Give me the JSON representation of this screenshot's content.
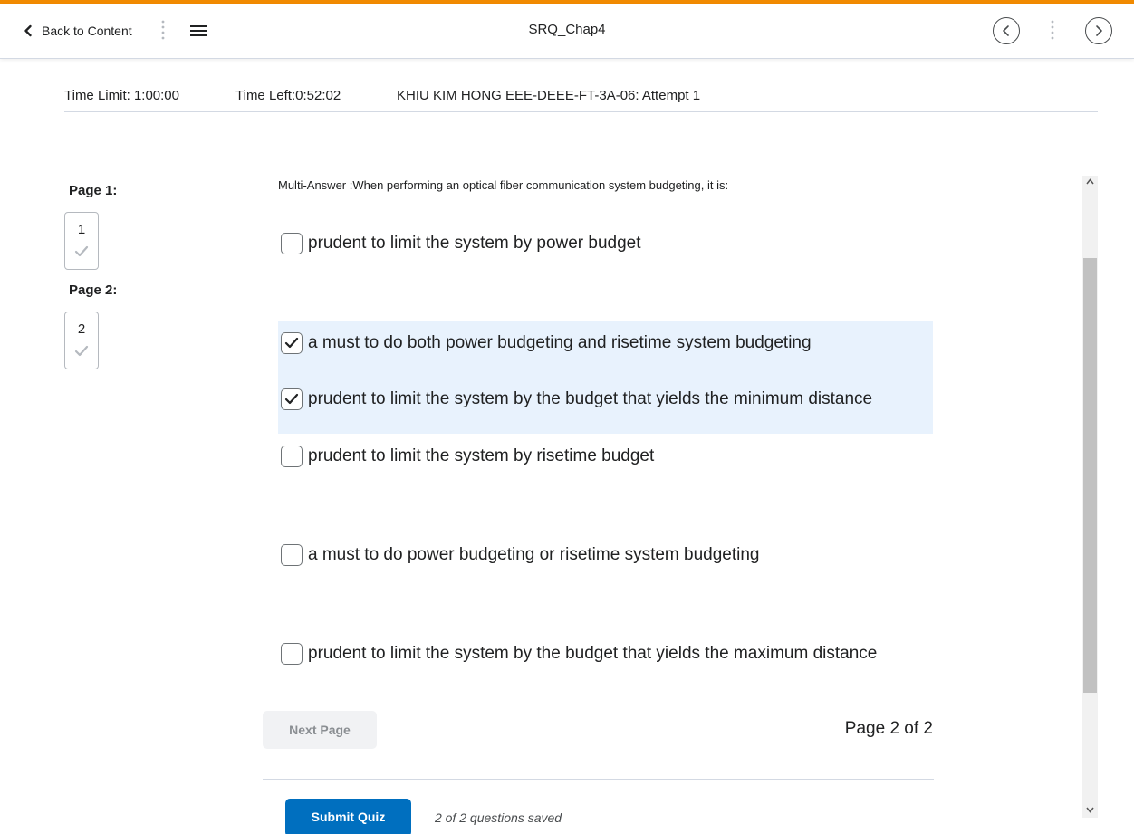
{
  "colors": {
    "accent": "#f18a00",
    "primary_button": "#006fbf",
    "highlight": "#e8f2fd"
  },
  "header": {
    "back_label": "Back to Content",
    "title": "SRQ_Chap4",
    "icons": [
      "chevron-left-icon",
      "vertical-dots-icon",
      "menu-icon",
      "previous-circle-icon",
      "next-circle-icon"
    ]
  },
  "quiz_info": {
    "time_limit": "Time Limit: 1:00:00",
    "time_left": "Time Left:0:52:02",
    "attempt": "KHIU KIM HONG EEE-DEEE-FT-3A-06: Attempt 1"
  },
  "sidebar": {
    "pages": [
      {
        "label": "Page 1:",
        "number": "1",
        "answered": true
      },
      {
        "label": "Page 2:",
        "number": "2",
        "answered": true
      }
    ]
  },
  "question": {
    "text": "Multi-Answer :When performing an optical fiber communication system budgeting, it is:",
    "options": [
      {
        "text": "prudent to limit the system by power budget",
        "checked": false
      },
      {
        "text": "a must to do both power budgeting and risetime system budgeting",
        "checked": true
      },
      {
        "text": "prudent to limit the system by the budget that yields the minimum distance",
        "checked": true
      },
      {
        "text": "prudent to limit the system by risetime budget",
        "checked": false
      },
      {
        "text": "a must to do power budgeting or risetime system budgeting",
        "checked": false
      },
      {
        "text": "prudent to limit the system by the budget that yields the maximum distance",
        "checked": false
      }
    ]
  },
  "footer": {
    "next_page_label": "Next Page",
    "page_indicator": "Page 2 of 2",
    "submit_label": "Submit Quiz",
    "saved_status": "2 of 2 questions saved"
  }
}
